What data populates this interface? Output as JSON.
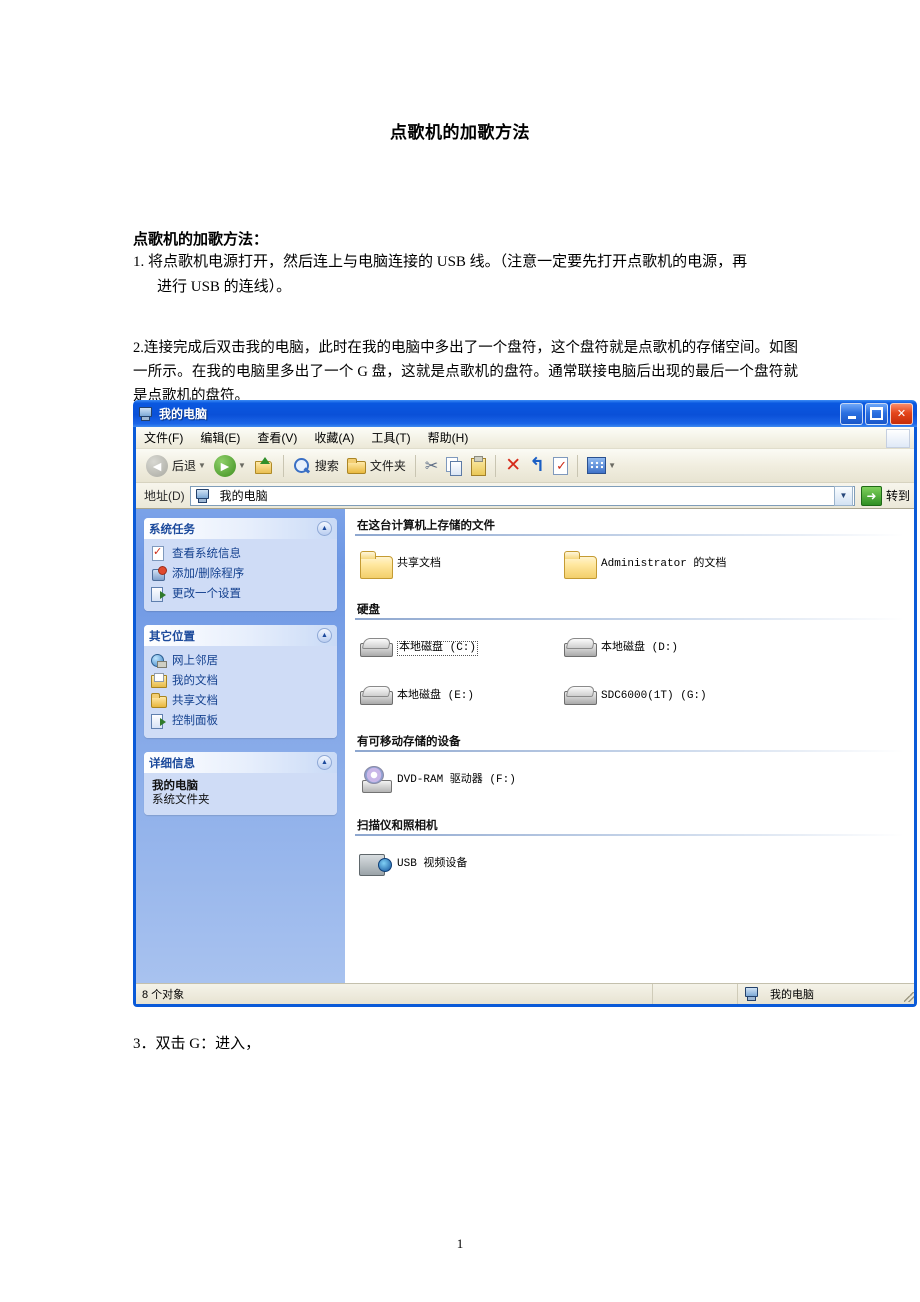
{
  "document": {
    "title": "点歌机的加歌方法",
    "section_heading": "点歌机的加歌方法：",
    "step1_main": "1. 将点歌机电源打开，然后连上与电脑连接的 USB 线。（注意一定要先打开点歌机的电源，再",
    "step1_cont": "进行 USB 的连线）。",
    "step2": "2.连接完成后双击我的电脑，此时在我的电脑中多出了一个盘符，这个盘符就是点歌机的存储空间。如图一所示。在我的电脑里多出了一个 G 盘，这就是点歌机的盘符。通常联接电脑后出现的最后一个盘符就是点歌机的盘符。",
    "step3": "3．双击 G：进入，",
    "page_number": "1"
  },
  "window": {
    "title": "我的电脑",
    "title_icon": "my-computer-icon",
    "buttons": {
      "minimize": "最小化",
      "maximize": "最大化",
      "close": "关闭"
    },
    "menu": [
      {
        "label": "文件(F)"
      },
      {
        "label": "编辑(E)"
      },
      {
        "label": "查看(V)"
      },
      {
        "label": "收藏(A)"
      },
      {
        "label": "工具(T)"
      },
      {
        "label": "帮助(H)"
      }
    ],
    "toolbar": {
      "back": "后退",
      "forward": "",
      "up": "",
      "search": "搜索",
      "folders": "文件夹",
      "cut": "",
      "copy": "",
      "paste": "",
      "delete": "",
      "undo": "",
      "properties": "",
      "views": ""
    },
    "address": {
      "label": "地址(D)",
      "value": "我的电脑",
      "go_label": "转到"
    },
    "sidebar": {
      "panels": [
        {
          "title": "系统任务",
          "items": [
            {
              "label": "查看系统信息",
              "icon": "system-info-icon"
            },
            {
              "label": "添加/删除程序",
              "icon": "add-remove-programs-icon"
            },
            {
              "label": "更改一个设置",
              "icon": "change-setting-icon"
            }
          ]
        },
        {
          "title": "其它位置",
          "items": [
            {
              "label": "网上邻居",
              "icon": "network-places-icon"
            },
            {
              "label": "我的文档",
              "icon": "my-documents-icon"
            },
            {
              "label": "共享文档",
              "icon": "shared-documents-icon"
            },
            {
              "label": "控制面板",
              "icon": "control-panel-icon"
            }
          ]
        },
        {
          "title": "详细信息",
          "detail_name": "我的电脑",
          "detail_type": "系统文件夹"
        }
      ]
    },
    "groups": [
      {
        "heading": "在这台计算机上存储的文件",
        "items": [
          {
            "label": "共享文档",
            "icon": "folder-icon",
            "selected": false
          },
          {
            "label": "Administrator 的文档",
            "icon": "folder-icon",
            "selected": false
          }
        ]
      },
      {
        "heading": "硬盘",
        "items": [
          {
            "label": "本地磁盘 (C:)",
            "icon": "hard-disk-icon",
            "selected": true
          },
          {
            "label": "本地磁盘 (D:)",
            "icon": "hard-disk-icon",
            "selected": false
          },
          {
            "label": "本地磁盘 (E:)",
            "icon": "hard-disk-icon",
            "selected": false
          },
          {
            "label": "SDC6000(1T) (G:)",
            "icon": "hard-disk-icon",
            "selected": false
          }
        ]
      },
      {
        "heading": "有可移动存储的设备",
        "items": [
          {
            "label": "DVD-RAM 驱动器 (F:)",
            "icon": "dvd-drive-icon",
            "selected": false
          }
        ]
      },
      {
        "heading": "扫描仪和照相机",
        "items": [
          {
            "label": "USB 视频设备",
            "icon": "camera-icon",
            "selected": false
          }
        ]
      }
    ],
    "statusbar": {
      "object_count": "8 个对象",
      "middle": "",
      "location": "我的电脑"
    }
  },
  "colors": {
    "titlebar_blue": "#0a58e0",
    "sidebar_blue": "#7ba2e8",
    "panel_bg": "#cfdcf6",
    "link_text": "#14418f",
    "close_red": "#c62d09"
  }
}
